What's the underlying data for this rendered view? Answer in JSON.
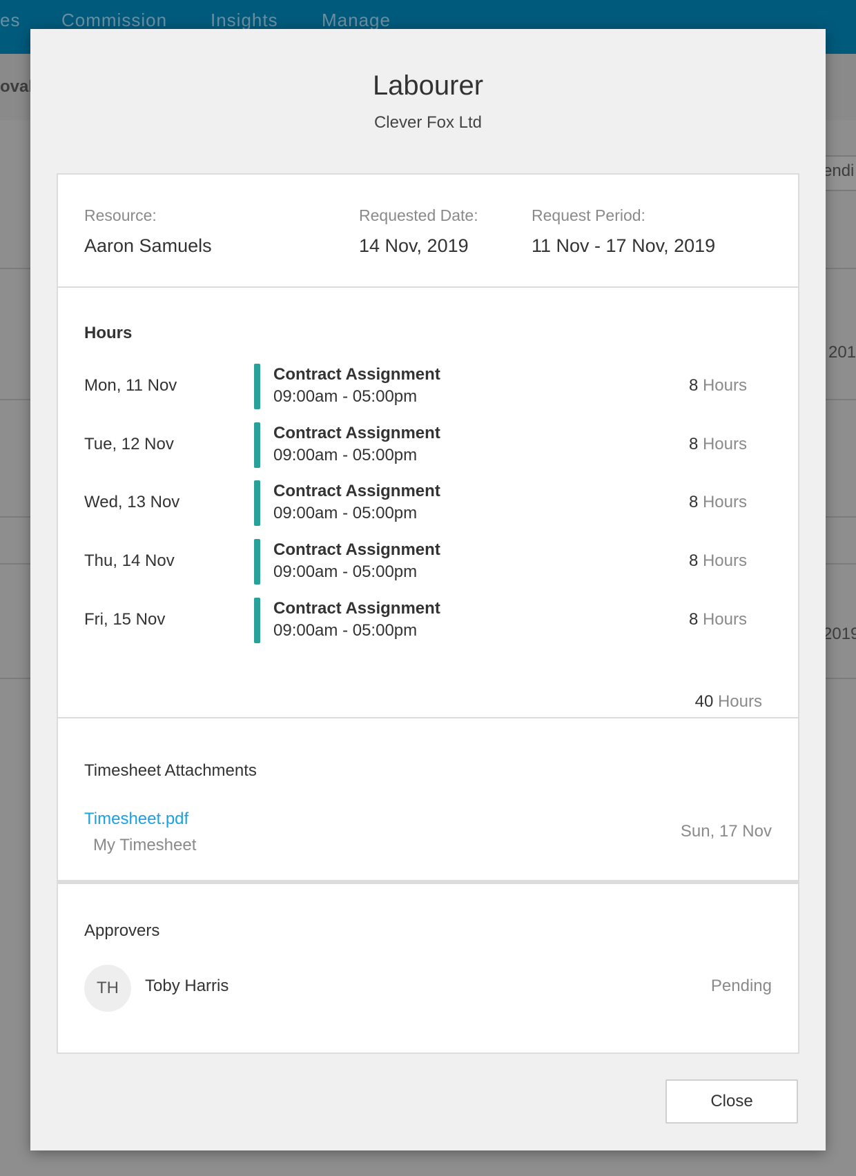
{
  "background": {
    "nav": [
      "es",
      "Commission",
      "Insights",
      "Manage"
    ],
    "subbar_fragment": "oval",
    "right_fragments": [
      "endi",
      "201",
      "2019"
    ]
  },
  "modal": {
    "title": "Labourer",
    "subtitle": "Clever Fox Ltd",
    "details": {
      "resource_label": "Resource:",
      "resource_value": "Aaron Samuels",
      "requested_date_label": "Requested Date:",
      "requested_date_value": "14 Nov, 2019",
      "request_period_label": "Request Period:",
      "request_period_value": "11 Nov - 17 Nov, 2019"
    },
    "hours": {
      "title": "Hours",
      "unit": "Hours",
      "rows": [
        {
          "day": "Mon, 11 Nov",
          "assignment": "Contract Assignment",
          "time": "09:00am - 05:00pm",
          "hours": "8"
        },
        {
          "day": "Tue, 12 Nov",
          "assignment": "Contract Assignment",
          "time": "09:00am - 05:00pm",
          "hours": "8"
        },
        {
          "day": "Wed, 13 Nov",
          "assignment": "Contract Assignment",
          "time": "09:00am - 05:00pm",
          "hours": "8"
        },
        {
          "day": "Thu, 14 Nov",
          "assignment": "Contract Assignment",
          "time": "09:00am - 05:00pm",
          "hours": "8"
        },
        {
          "day": "Fri, 15 Nov",
          "assignment": "Contract Assignment",
          "time": "09:00am - 05:00pm",
          "hours": "8"
        }
      ],
      "total": "40"
    },
    "attachments": {
      "title": "Timesheet Attachments",
      "file_name": "Timesheet.pdf",
      "file_description": "My Timesheet",
      "file_date": "Sun, 17 Nov"
    },
    "approvers": {
      "title": "Approvers",
      "initials": "TH",
      "name": "Toby Harris",
      "status": "Pending"
    },
    "close_label": "Close"
  },
  "colors": {
    "nav_bar": "#005a7c",
    "accent_bar": "#2aa198",
    "link": "#1ea0e0"
  }
}
